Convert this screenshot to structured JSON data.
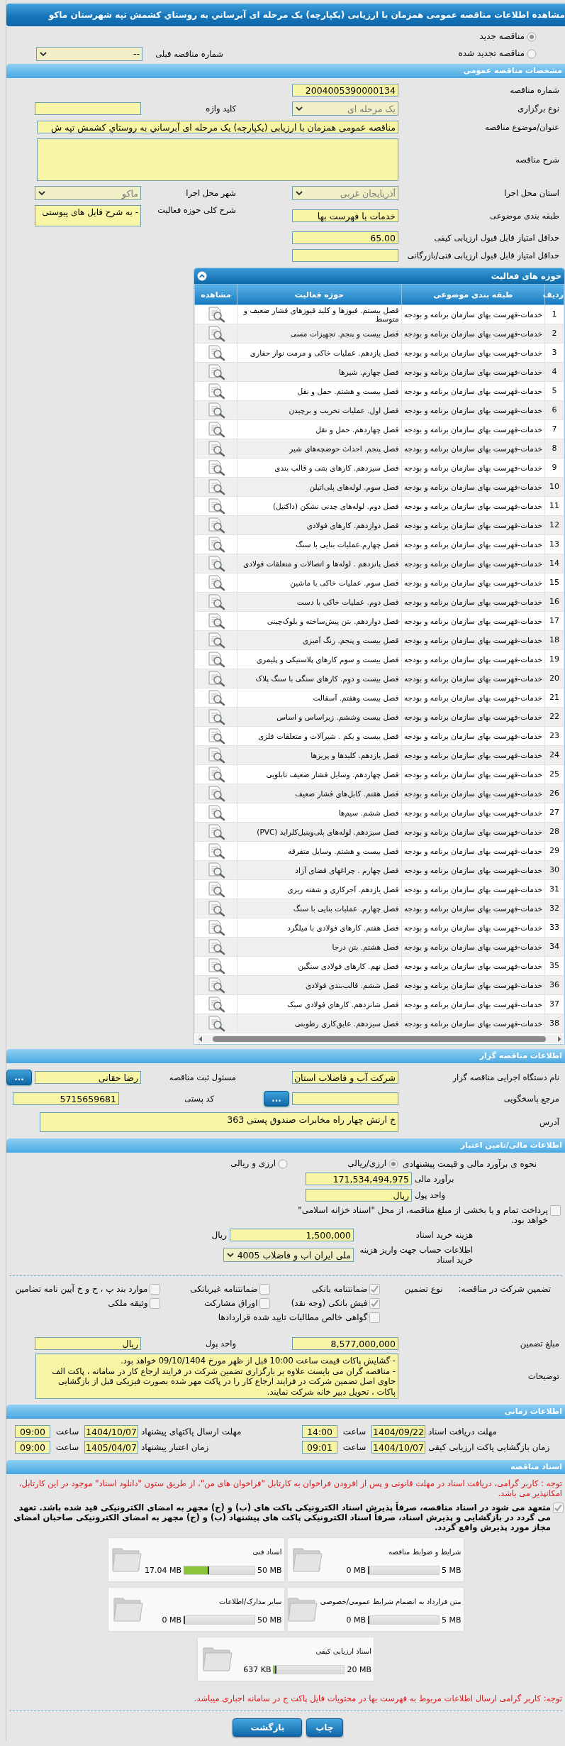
{
  "title": "مشاهده اطلاعات مناقصه عمومی همزمان با ارزیابی (یکپارچه) یک مرحله ای آبرساني به روستاي کشمش تپه شهرستان ماکو",
  "tender_status": [
    {
      "label": "مناقصه جدید",
      "selected": true
    },
    {
      "label": "مناقصه تجدید شده",
      "selected": false
    }
  ],
  "previous_tender": {
    "label": "شماره مناقصه قبلی",
    "kind": "select",
    "value": "--",
    "disabled": false
  },
  "general": {
    "header": "مشخصات مناقصه عمومی",
    "rows": [
      [
        {
          "label": "شماره مناقصه",
          "kind": "text",
          "value": "2004005390000134"
        }
      ],
      [
        {
          "label": "نوع برگزاری",
          "kind": "select",
          "value": "یک مرحله ای",
          "disabled": true
        },
        {
          "label": "کلید واژه",
          "kind": "text"
        }
      ],
      [
        {
          "label": "عنوان/موضوع مناقصه",
          "kind": "wide",
          "value": "مناقصه عمومی همزمان با ارزیابی (یکپارچه) یک مرحله ای آبرساني به روستاي کشمش تپه ش"
        }
      ],
      [
        {
          "label": "شرح مناقصه",
          "kind": "textarea"
        }
      ],
      [
        {
          "label": "استان محل اجرا",
          "kind": "select",
          "value": "آذربایجان غربی",
          "disabled": true
        },
        {
          "label": "شهر محل اجرا",
          "kind": "select",
          "value": "ماکو",
          "disabled": true
        }
      ],
      [
        {
          "label": "طبقه بندی موضوعی",
          "kind": "text",
          "value": "خدمات با فهرست بها"
        },
        {
          "label": "شرح کلی حوزه فعالیت",
          "kind": "note",
          "value": "- به شرح فایل های پیوستی"
        }
      ],
      [
        {
          "label": "حداقل امتیاز قابل قبول ارزیابی کیفی",
          "kind": "text",
          "value": "65.00"
        }
      ],
      [
        {
          "label": "حداقل امتیاز قابل قبول ارزیابی فنی/بازرگانی",
          "kind": "text"
        }
      ]
    ]
  },
  "activities": {
    "header": "حوزه های فعالیت",
    "columns": [
      "ردیف",
      "طبقه بندی موضوعی",
      "حوزه فعالیت",
      "مشاهده"
    ],
    "rows": [
      {
        "index": "1",
        "category": "خدمات-فهرست بهای سازمان برنامه و بودجه",
        "activity": "فصل بیستم. فیوزها و کلید فیوزهای فشار ضعیف و متوسط"
      },
      {
        "index": "2",
        "category": "خدمات-فهرست بهای سازمان برنامه و بودجه",
        "activity": "فصل بیست و پنجم. تجهیزات مسی"
      },
      {
        "index": "3",
        "category": "خدمات-فهرست بهای سازمان برنامه و بودجه",
        "activity": "فصل یازدهم. عملیات خاکی و مرمت نوار حفاری"
      },
      {
        "index": "4",
        "category": "خدمات-فهرست بهای سازمان برنامه و بودجه",
        "activity": "فصل چهارم. شیرها"
      },
      {
        "index": "5",
        "category": "خدمات-فهرست بهای سازمان برنامه و بودجه",
        "activity": "فصل بیست و هشتم. حمل و نقل"
      },
      {
        "index": "6",
        "category": "خدمات-فهرست بهای سازمان برنامه و بودجه",
        "activity": "فصل اول. عملیات تخریب و برچیدن"
      },
      {
        "index": "7",
        "category": "خدمات-فهرست بهای سازمان برنامه و بودجه",
        "activity": "فصل چهاردهم. حمل و نقل"
      },
      {
        "index": "8",
        "category": "خدمات-فهرست بهای سازمان برنامه و بودجه",
        "activity": "فصل پنجم. احداث حوضچه‌های شیر"
      },
      {
        "index": "9",
        "category": "خدمات-فهرست بهای سازمان برنامه و بودجه",
        "activity": "فصل سیزدهم. کارهای بتنی و قالب بندی"
      },
      {
        "index": "10",
        "category": "خدمات-فهرست بهای سازمان برنامه و بودجه",
        "activity": "فصل سوم. لوله‌های پلی‌اتیلن"
      },
      {
        "index": "11",
        "category": "خدمات-فهرست بهای سازمان برنامه و بودجه",
        "activity": "فصل دوم. لوله‌های چدنی نشکن (داکتیل)"
      },
      {
        "index": "12",
        "category": "خدمات-فهرست بهای سازمان برنامه و بودجه",
        "activity": "فصل دوازدهم. کارهای فولادی"
      },
      {
        "index": "13",
        "category": "خدمات-فهرست بهای سازمان برنامه و بودجه",
        "activity": "فصل چهارم.عملیات بنایی با سنگ"
      },
      {
        "index": "14",
        "category": "خدمات-فهرست بهای سازمان برنامه و بودجه",
        "activity": "فصل پانزدهم . لوله‌ها و اتصالات و متعلقات فولادی"
      },
      {
        "index": "15",
        "category": "خدمات-فهرست بهای سازمان برنامه و بودجه",
        "activity": "فصل سوم. عملیات خاکی با ماشین"
      },
      {
        "index": "16",
        "category": "خدمات-فهرست بهای سازمان برنامه و بودجه",
        "activity": "فصل دوم. عملیات خاکی با دست"
      },
      {
        "index": "17",
        "category": "خدمات-فهرست بهای سازمان برنامه و بودجه",
        "activity": "فصل دوازدهم. بتن پیش‌ساخته و بلوک‌چینی"
      },
      {
        "index": "18",
        "category": "خدمات-فهرست بهای سازمان برنامه و بودجه",
        "activity": "فصل بیست و پنجم. رنگ آمیزی"
      },
      {
        "index": "19",
        "category": "خدمات-فهرست بهای سازمان برنامه و بودجه",
        "activity": "فصل بیست و سوم کارهای پلاستیکی و پلیمری"
      },
      {
        "index": "20",
        "category": "خدمات-فهرست بهای سازمان برنامه و بودجه",
        "activity": "فصل بیست و دوم. کارهای سنگی با سنگ پلاک"
      },
      {
        "index": "21",
        "category": "خدمات-فهرست بهای سازمان برنامه و بودجه",
        "activity": "فصل بیست وهفتم. آسفالت"
      },
      {
        "index": "22",
        "category": "خدمات-فهرست بهای سازمان برنامه و بودجه",
        "activity": "فصل بیست وششم. زیراساس و اساس"
      },
      {
        "index": "23",
        "category": "خدمات-فهرست بهای سازمان برنامه و بودجه",
        "activity": "فصل بیست و یکم . شیرآلات و متعلقات فلزی"
      },
      {
        "index": "24",
        "category": "خدمات-فهرست بهای سازمان برنامه و بودجه",
        "activity": "فصل یازدهم. کلیدها و پریزها"
      },
      {
        "index": "25",
        "category": "خدمات-فهرست بهای سازمان برنامه و بودجه",
        "activity": "فصل چهاردهم. وسایل فشار ضعیف تابلویی"
      },
      {
        "index": "26",
        "category": "خدمات-فهرست بهای سازمان برنامه و بودجه",
        "activity": "فصل هفتم. کابل‌های فشار ضعیف"
      },
      {
        "index": "27",
        "category": "خدمات-فهرست بهای سازمان برنامه و بودجه",
        "activity": "فصل ششم. سیم‌ها"
      },
      {
        "index": "28",
        "category": "خدمات-فهرست بهای سازمان برنامه و بودجه",
        "activity": "فصل سیزدهم. لوله‌های پلی‌وینیل‌کلراید (PVC)"
      },
      {
        "index": "29",
        "category": "خدمات-فهرست بهای سازمان برنامه و بودجه",
        "activity": "فصل بیست و هشتم. وسایل متفرقه"
      },
      {
        "index": "30",
        "category": "خدمات-فهرست بهای سازمان برنامه و بودجه",
        "activity": "فصل چهارم . چراغهای فضای آزاد"
      },
      {
        "index": "31",
        "category": "خدمات-فهرست بهای سازمان برنامه و بودجه",
        "activity": "فصل یازدهم. آجرکاری و شفته ریزی"
      },
      {
        "index": "32",
        "category": "خدمات-فهرست بهای سازمان برنامه و بودجه",
        "activity": "فصل چهارم. عملیات بنایی با سنگ"
      },
      {
        "index": "33",
        "category": "خدمات-فهرست بهای سازمان برنامه و بودجه",
        "activity": "فصل هفتم. کارهای فولادی با میلگرد"
      },
      {
        "index": "34",
        "category": "خدمات-فهرست بهای سازمان برنامه و بودجه",
        "activity": "فصل هشتم. بتن درجا"
      },
      {
        "index": "35",
        "category": "خدمات-فهرست بهای سازمان برنامه و بودجه",
        "activity": "فصل نهم. کارهای فولادی سنگین"
      },
      {
        "index": "36",
        "category": "خدمات-فهرست بهای سازمان برنامه و بودجه",
        "activity": "فصل ششم. قالب‌بندی فولادی"
      },
      {
        "index": "37",
        "category": "خدمات-فهرست بهای سازمان برنامه و بودجه",
        "activity": "فصل شانزدهم. کارهای فولادی سبک"
      },
      {
        "index": "38",
        "category": "خدمات-فهرست بهای سازمان برنامه و بودجه",
        "activity": "فصل سیزدهم. عایق‌کاری رطوبتی"
      }
    ]
  },
  "tenderer": {
    "header": "اطلاعات مناقصه گزار",
    "rows": [
      [
        {
          "label": "نام دستگاه اجرایی مناقصه گزار",
          "kind": "text",
          "value": "شرکت آب و فاضلاب استان"
        },
        {
          "label": "مسئول ثبت مناقصه",
          "kind": "text",
          "value": "رضا حقانی",
          "button": "..."
        }
      ],
      [
        {
          "label": "مرجع پاسخگویی",
          "kind": "text",
          "button": "..."
        },
        {
          "label": "کد پستی",
          "kind": "text",
          "value": "5715659681"
        }
      ],
      [
        {
          "label": "آدرس",
          "kind": "address",
          "value": "خ ارتش چهار راه مخابرات صندوق پستی 363"
        }
      ]
    ]
  },
  "finance": {
    "header": "اطلاعات مالی/تامین اعتبار",
    "estimate_method": {
      "label": "نحوه ی برآورد مالی و قیمت پیشنهادی",
      "options": [
        {
          "label": "ارزی/ریالی",
          "selected": true
        },
        {
          "label": "ارزی و ریالی",
          "selected": false
        }
      ]
    },
    "fields": [
      {
        "label": "برآورد مالی",
        "kind": "text",
        "value": "171,534,494,975"
      },
      {
        "label": "واحد پول",
        "kind": "text",
        "value": "ریال"
      }
    ],
    "treasury": {
      "label": "پرداخت تمام و یا بخشی از مبلغ مناقصه، از محل \"اسناد خزانه اسلامی\" خواهد بود.",
      "checked": false
    },
    "purchase": [
      {
        "label": "هزینه خرید اسناد",
        "kind": "text",
        "value": "1,500,000",
        "suffix": "ریال"
      },
      {
        "label": "اطلاعات حساب جهت واریز هزینه خرید اسناد",
        "kind": "select",
        "value": "ملی ایران اب و فاضلاب 4005",
        "disabled": false
      }
    ],
    "guarantee": {
      "label": "تضمین شرکت در مناقصه:",
      "type_label": "نوع تضمین",
      "options": [
        {
          "label": "ضمانتنامه بانکی",
          "checked": true
        },
        {
          "label": "ضمانتنامه غیربانکی",
          "checked": false
        },
        {
          "label": "موارد بند پ ، ح و خ آیین نامه تضامین",
          "checked": false
        },
        {
          "label": "فیش بانکی (وجه نقد)",
          "checked": true
        },
        {
          "label": "اوراق مشارکت",
          "checked": false
        },
        {
          "label": "وثیقه ملکی",
          "checked": false
        },
        {
          "label": "گواهی خالص مطالبات تایید شده قراردادها",
          "checked": false
        }
      ]
    },
    "guarantee_rows": [
      [
        {
          "label": "مبلغ تضمین",
          "kind": "text",
          "value": "8,577,000,000"
        },
        {
          "label": "واحد پول",
          "kind": "text",
          "value": "ریال"
        }
      ],
      [
        {
          "label": "توضیحات",
          "kind": "notes",
          "value": "- گشایش پاکات قیمت ساعت 10:00 قبل از ظهر مورخ 09/10/1404 خواهد بود.\n- مناقصه گران می بایست علاوه بر بارگزاری تضمین شرکت در فرایند ارجاع کار در سامانه ، پاکت الف حاوی اصل تضمین شرکت در فرایند ارجاع کار را در پاکت مهر شده بصورت فیزیکی قبل از بازگشایی پاکات ، تحویل دبیر خانه شرکت نمایند."
        }
      ]
    ]
  },
  "timing": {
    "header": "اطلاعات زمانی",
    "rows": [
      [
        {
          "label": "مهلت دریافت اسناد",
          "date": "1404/09/22",
          "time_label": "ساعت",
          "time": "14:00"
        },
        {
          "label": "مهلت ارسال پاکتهای پیشنهاد",
          "date": "1404/10/07",
          "time_label": "ساعت",
          "time": "09:00"
        }
      ],
      [
        {
          "label": "زمان بازگشایی پاکت ارزیابی کیفی",
          "date": "1404/10/07",
          "time_label": "ساعت",
          "time": "09:01"
        },
        {
          "label": "زمان اعتبار پیشنهاد",
          "date": "1405/04/07",
          "time_label": "ساعت",
          "time": "09:00"
        }
      ]
    ]
  },
  "documents": {
    "header": "اسناد مناقصه",
    "notice": "توجه : کاربر گرامی، دریافت اسناد در مهلت قانونی و پس از افزودن فراخوان به کارتابل \"فراخوان های من\"، از طریق ستون \"دانلود اسناد\" موجود در این کارتابل، امکانپذیر می باشد.",
    "commitment": {
      "text": "متعهد می شود در اسناد مناقصه، صرفاً پذیرش اسناد الکترونیکی پاکت های (ب) و (ج) مجهز به امضای الکترونیکی قید شده باشد. تعهد می گردد در بازگشایی و پذیرش اسناد، صرفاً اسناد الکترونیکی پاکت های پیشنهاد (ب) و (ج) مجهز به امضای الکترونیکی صاحبان امضای مجاز مورد پذیرش واقع گردد.",
      "checked": true
    },
    "files": [
      {
        "name": "شرایط و ضوابط مناقصه",
        "used": "0 MB",
        "max": "5 MB",
        "level": 0
      },
      {
        "name": "اسناد فنی",
        "used": "17.04 MB",
        "max": "50 MB",
        "level": 0.34
      },
      {
        "name": "متن قرارداد به انضمام شرایط عمومی/خصوصی",
        "used": "0 MB",
        "max": "5 MB",
        "level": 0
      },
      {
        "name": "سایر مدارک/اطلاعات",
        "used": "0 MB",
        "max": "50 MB",
        "level": 0
      },
      {
        "name": "اسناد ارزیابی کیفی",
        "used": "637 KB",
        "max": "20 MB",
        "level": 0.03
      }
    ],
    "footer_note": "توجه: کاربر گرامی ارسال اطلاعات مربوط به فهرست بها در محتویات فایل پاکت ج در سامانه اجباری میباشد."
  },
  "buttons": [
    "چاپ",
    "بازگشت"
  ]
}
